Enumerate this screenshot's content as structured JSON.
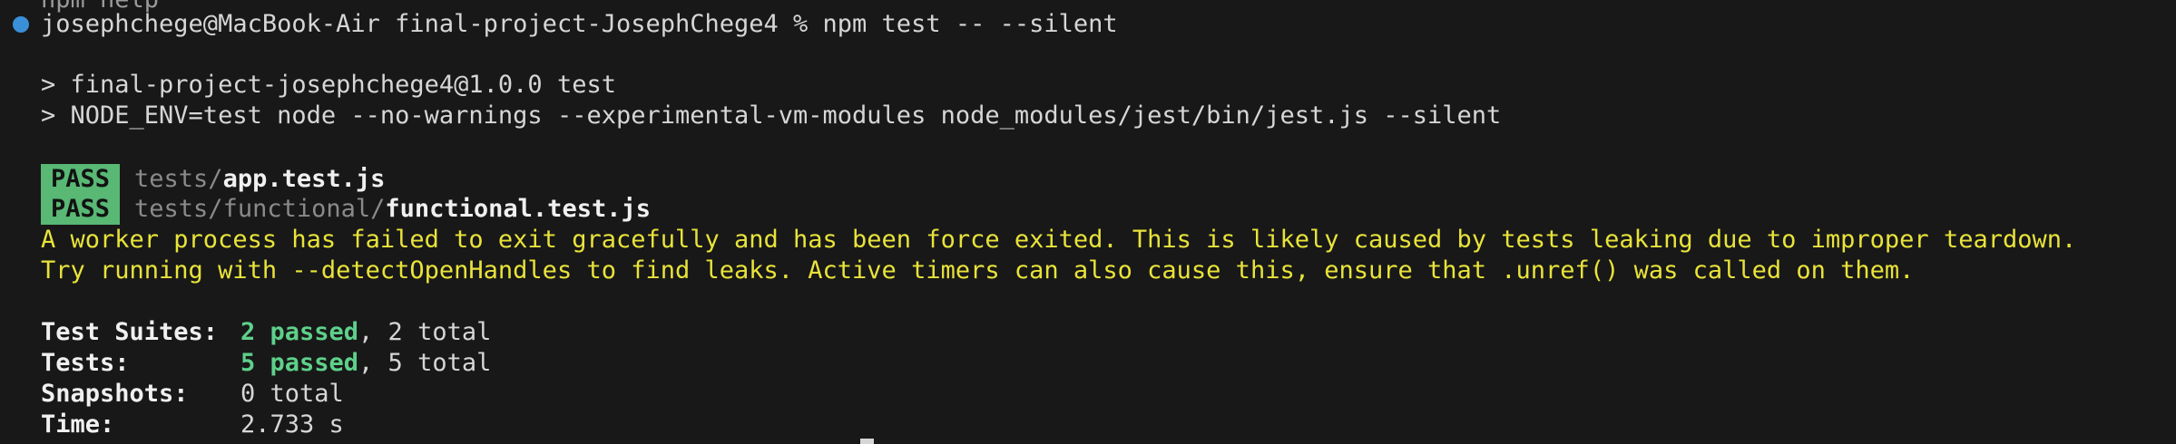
{
  "terminal": {
    "previous_line": "npm help",
    "prompt": "josephchege@MacBook-Air final-project-JosephChege4 % npm test -- --silent",
    "script_line_1": "> final-project-josephchege4@1.0.0 test",
    "script_line_2": "> NODE_ENV=test node --no-warnings --experimental-vm-modules node_modules/jest/bin/jest.js --silent",
    "results": [
      {
        "status": "PASS",
        "dir": "tests/",
        "file": "app.test.js"
      },
      {
        "status": "PASS",
        "dir": "tests/functional/",
        "file": "functional.test.js"
      }
    ],
    "warning_line_1": "A worker process has failed to exit gracefully and has been force exited. This is likely caused by tests leaking due to improper teardown.",
    "warning_line_2": "Try running with --detectOpenHandles to find leaks. Active timers can also cause this, ensure that .unref() was called on them.",
    "summary": {
      "suites_label": "Test Suites:",
      "suites_passed": "2 passed",
      "suites_rest": ", 2 total",
      "tests_label": "Tests:",
      "tests_passed": "5 passed",
      "tests_rest": ", 5 total",
      "snapshots_label": "Snapshots:",
      "snapshots_value": "0 total",
      "time_label": "Time:",
      "time_value": "2.733 s"
    },
    "colors": {
      "background": "#181818",
      "pass_badge": "#58b874",
      "passed_text": "#5ed08a",
      "warning_text": "#e8e33a",
      "prompt_dot": "#3a8fd8"
    }
  }
}
